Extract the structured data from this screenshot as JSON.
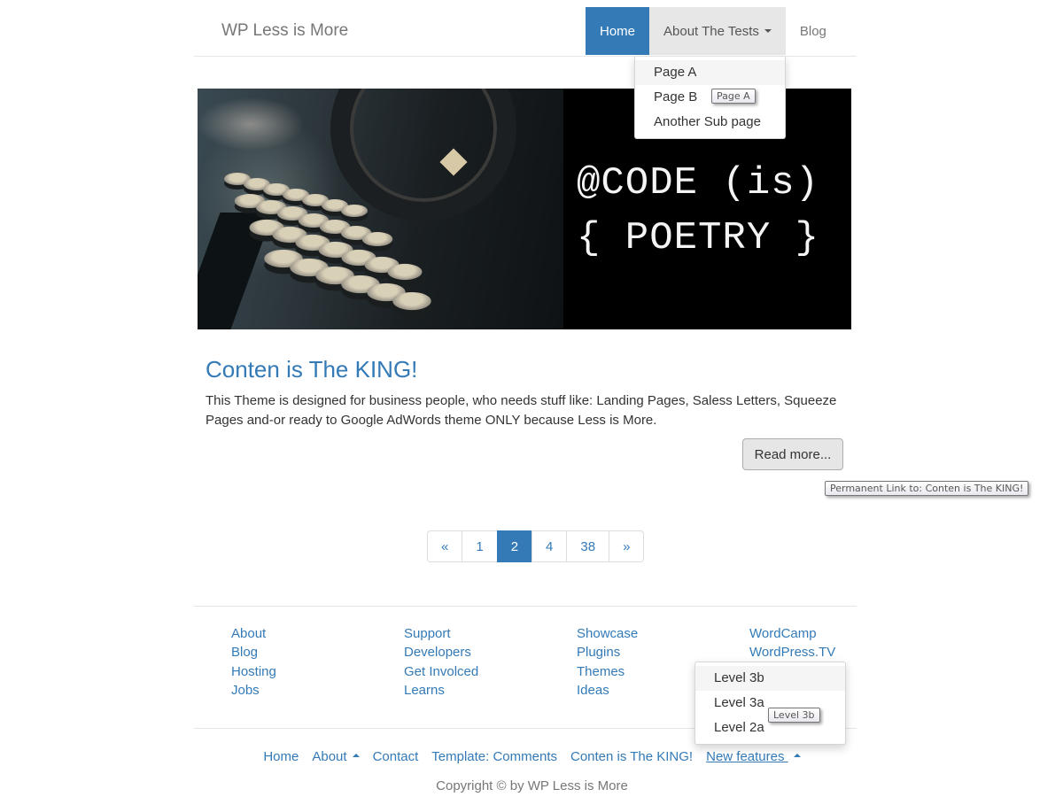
{
  "navbar": {
    "brand": "WP Less is More",
    "items": [
      {
        "label": "Home",
        "state": "active"
      },
      {
        "label": "About The Tests",
        "state": "open",
        "has_caret": true
      },
      {
        "label": "Blog",
        "state": "normal"
      }
    ],
    "dropdown": {
      "items": [
        {
          "label": "Page A",
          "hovered": true
        },
        {
          "label": "Page B"
        },
        {
          "label": "Another Sub page"
        }
      ],
      "tooltip": "Page A"
    }
  },
  "hero": {
    "image_alt": "typewriter",
    "code_line1": "@CODE (is)",
    "code_line2": "{ POETRY }"
  },
  "post": {
    "title": "Conten is The KING!",
    "excerpt": "This Theme is designed for business people, who needs stuff like: Landing Pages, Saless Letters, Squeeze Pages and-or ready to Google AdWords theme ONLY because Less is More.",
    "read_more_label": "Read more...",
    "read_more_tooltip": "Permanent Link to: Conten is The KING!"
  },
  "pagination": {
    "prev": "«",
    "pages": [
      "1",
      "2",
      "4",
      "38"
    ],
    "current": "2",
    "next": "»"
  },
  "footer": {
    "columns": [
      [
        "About",
        "Blog",
        "Hosting",
        "Jobs"
      ],
      [
        "Support",
        "Developers",
        "Get Involced",
        "Learns"
      ],
      [
        "Showcase",
        "Plugins",
        "Themes",
        "Ideas"
      ],
      [
        "WordCamp",
        "WordPress.TV"
      ]
    ],
    "dropdown": {
      "items": [
        {
          "label": "Level 3b",
          "hovered": true
        },
        {
          "label": "Level 3a"
        },
        {
          "label": "Level 2a"
        }
      ],
      "tooltip": "Level 3b"
    },
    "menu": [
      {
        "label": "Home"
      },
      {
        "label": "About",
        "caret_up": true
      },
      {
        "label": "Contact"
      },
      {
        "label": "Template: Comments"
      },
      {
        "label": "Conten is The KING!"
      },
      {
        "label": "New features",
        "caret_up": true,
        "underlined": true
      }
    ],
    "copyright": "Copyright © by WP Less is More"
  },
  "colors": {
    "brand_blue": "#337ab7",
    "nav_open_bg": "#e7e7e7",
    "text": "#333333",
    "muted": "#777777"
  }
}
